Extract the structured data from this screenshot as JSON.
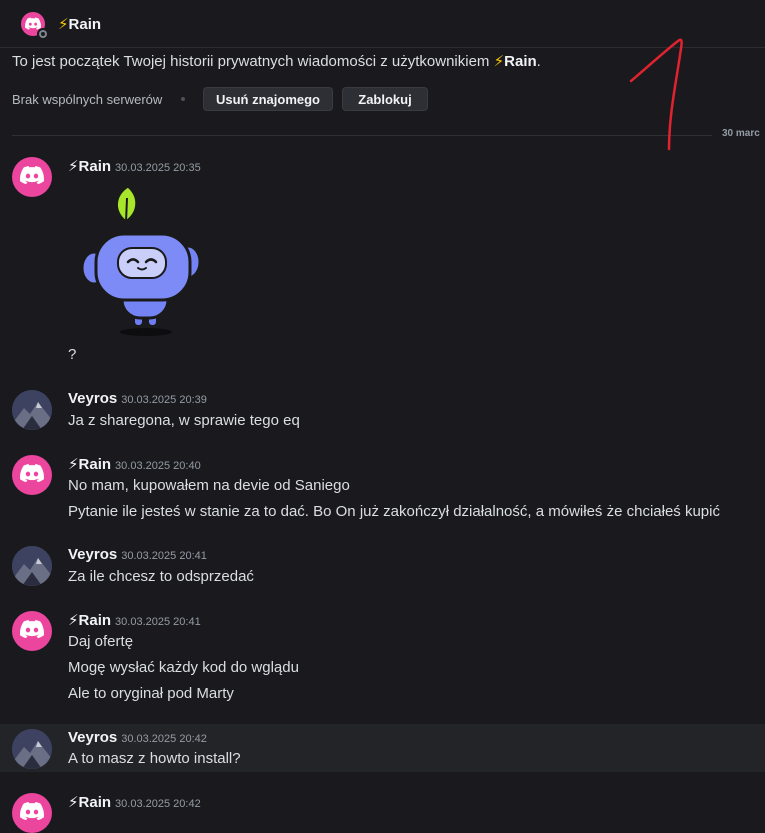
{
  "header": {
    "bolt": "⚡",
    "name": "Rain"
  },
  "intro": {
    "text": "To jest początek Twojej historii prywatnych wiadomości z użytkownikiem",
    "bolt": "⚡",
    "name": "Rain",
    "period": "."
  },
  "profile_actions": {
    "mutual": "Brak wspólnych serwerów",
    "remove_friend": "Usuń znajomego",
    "block": "Zablokuj"
  },
  "date_divider": "30 marc",
  "messages": [
    {
      "author": "⚡Rain",
      "time": "30.03.2025 20:35",
      "lines": [
        "?"
      ],
      "has_sticker": true
    },
    {
      "author": "Veyros",
      "time": "30.03.2025 20:39",
      "lines": [
        "Ja z sharegona, w sprawie tego eq"
      ]
    },
    {
      "author": "⚡Rain",
      "time": "30.03.2025 20:40",
      "lines": [
        "No mam, kupowałem na devie od Saniego",
        "Pytanie ile jesteś w stanie za to dać. Bo On już zakończył działalność, a mówiłeś że chciałeś kupić"
      ]
    },
    {
      "author": "Veyros",
      "time": "30.03.2025 20:41",
      "lines": [
        "Za ile chcesz to odsprzedać"
      ]
    },
    {
      "author": "⚡Rain",
      "time": "30.03.2025 20:41",
      "lines": [
        "Daj ofertę",
        "Mogę wysłać każdy kod do wglądu",
        "Ale to oryginał pod Marty"
      ]
    },
    {
      "author": "Veyros",
      "time": "30.03.2025 20:42",
      "lines": [
        "A to masz z howto install?"
      ]
    },
    {
      "author": "⚡Rain",
      "time": "30.03.2025 20:42",
      "lines": []
    }
  ],
  "colors": {
    "background": "#1a1a1e",
    "rain_avatar": "#eb459e",
    "bolt": "#f5c400",
    "annotation": "#e0232e"
  },
  "icons": {
    "discord_avatar": "discord-logo-icon",
    "sticker": "wumpus-sticker"
  }
}
